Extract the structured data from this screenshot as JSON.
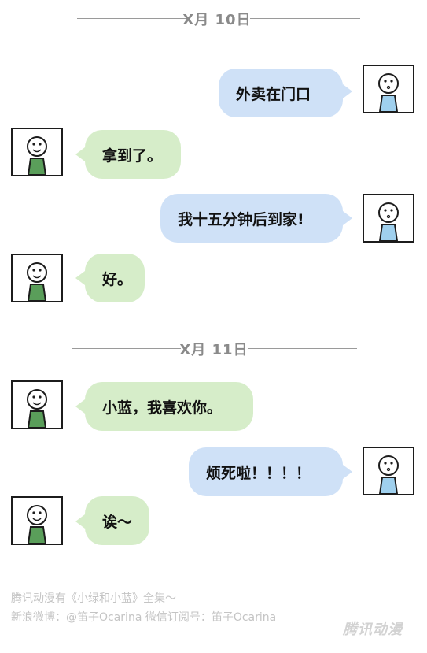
{
  "colors": {
    "green_bubble": "#d6edc9",
    "blue_bubble": "#cfe1f7",
    "green_shirt": "#5a9e5a",
    "blue_shirt": "#9fd0ee"
  },
  "separators": [
    "X月 10日",
    "X月 11日"
  ],
  "messages": [
    {
      "side": "right",
      "speaker": "blue",
      "text": "外卖在门口"
    },
    {
      "side": "left",
      "speaker": "green",
      "text": "拿到了。"
    },
    {
      "side": "right",
      "speaker": "blue",
      "text": "我十五分钟后到家!"
    },
    {
      "side": "left",
      "speaker": "green",
      "text": "好。"
    },
    {
      "side": "left",
      "speaker": "green",
      "text": "小蓝，我喜欢你。"
    },
    {
      "side": "right",
      "speaker": "blue",
      "text": "烦死啦！！！！"
    },
    {
      "side": "left",
      "speaker": "green",
      "text": "诶～"
    }
  ],
  "credits": {
    "line1": "腾讯动漫有《小绿和小蓝》全集～",
    "line2": "新浪微博：@笛子Ocarina    微信订阅号：笛子Ocarina",
    "logo": "腾讯动漫"
  }
}
